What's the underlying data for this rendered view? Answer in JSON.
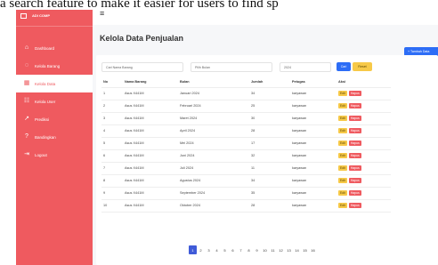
{
  "caption": "a search feature to make it easier for users to find sp",
  "brand": {
    "name": "ADI COMP",
    "icon": "monitor-icon"
  },
  "nav": [
    {
      "label": "Dashboard",
      "icon": "home-icon",
      "glyph": "⌂",
      "active": false
    },
    {
      "label": "Kelola Barang",
      "icon": "box-icon",
      "glyph": "◌",
      "active": false
    },
    {
      "label": "Kelola Data",
      "icon": "calendar-icon",
      "glyph": "▦",
      "active": true
    },
    {
      "label": "Kelola User",
      "icon": "users-icon",
      "glyph": "☷",
      "active": false
    },
    {
      "label": "Prediksi",
      "icon": "trend-icon",
      "glyph": "↗",
      "active": false
    },
    {
      "label": "Bandingkan",
      "icon": "question-icon",
      "glyph": "?",
      "active": false
    },
    {
      "label": "Logout",
      "icon": "logout-icon",
      "glyph": "⇥",
      "active": false
    }
  ],
  "header": {
    "menu_icon": "hamburger-icon",
    "title": "Kelola Data Penjualan",
    "add_label": "+ Tambah Data"
  },
  "filters": {
    "search_placeholder": "Cari Nama Barang",
    "month_placeholder": "Pilih Bulan",
    "year_value": "2024",
    "cari_label": "Cari",
    "reset_label": "Reset"
  },
  "table": {
    "columns": [
      "No",
      "Nama Barang",
      "Bulan",
      "Jumlah",
      "Petugas",
      "Aksi"
    ],
    "edit_label": "Edit",
    "hapus_label": "Hapus",
    "rows": [
      [
        "1",
        "Asus X441M",
        "Januari 2024",
        "34",
        "karyawan"
      ],
      [
        "2",
        "Asus X441M",
        "Februari 2024",
        "25",
        "karyawan"
      ],
      [
        "3",
        "Asus X441M",
        "Maret 2024",
        "30",
        "karyawan"
      ],
      [
        "4",
        "Asus X441M",
        "April 2024",
        "28",
        "karyawan"
      ],
      [
        "5",
        "Asus X441M",
        "Mei 2024",
        "17",
        "karyawan"
      ],
      [
        "6",
        "Asus X441M",
        "Juni 2024",
        "32",
        "karyawan"
      ],
      [
        "7",
        "Asus X441M",
        "Juli 2024",
        "11",
        "karyawan"
      ],
      [
        "8",
        "Asus X441M",
        "Agustus 2024",
        "34",
        "karyawan"
      ],
      [
        "9",
        "Asus X441M",
        "September 2024",
        "35",
        "karyawan"
      ],
      [
        "10",
        "Asus X441M",
        "Oktober 2024",
        "28",
        "karyawan"
      ]
    ]
  },
  "pagination": {
    "pages": [
      "1",
      "2",
      "3",
      "4",
      "5",
      "6",
      "7",
      "8",
      "9",
      "10",
      "11",
      "12",
      "13",
      "14",
      "15",
      "16"
    ],
    "active": "1"
  },
  "colors": {
    "sidebar": "#ef5a5f",
    "primary": "#2d6df6",
    "warning": "#f7c948",
    "danger": "#ef5a5f"
  }
}
